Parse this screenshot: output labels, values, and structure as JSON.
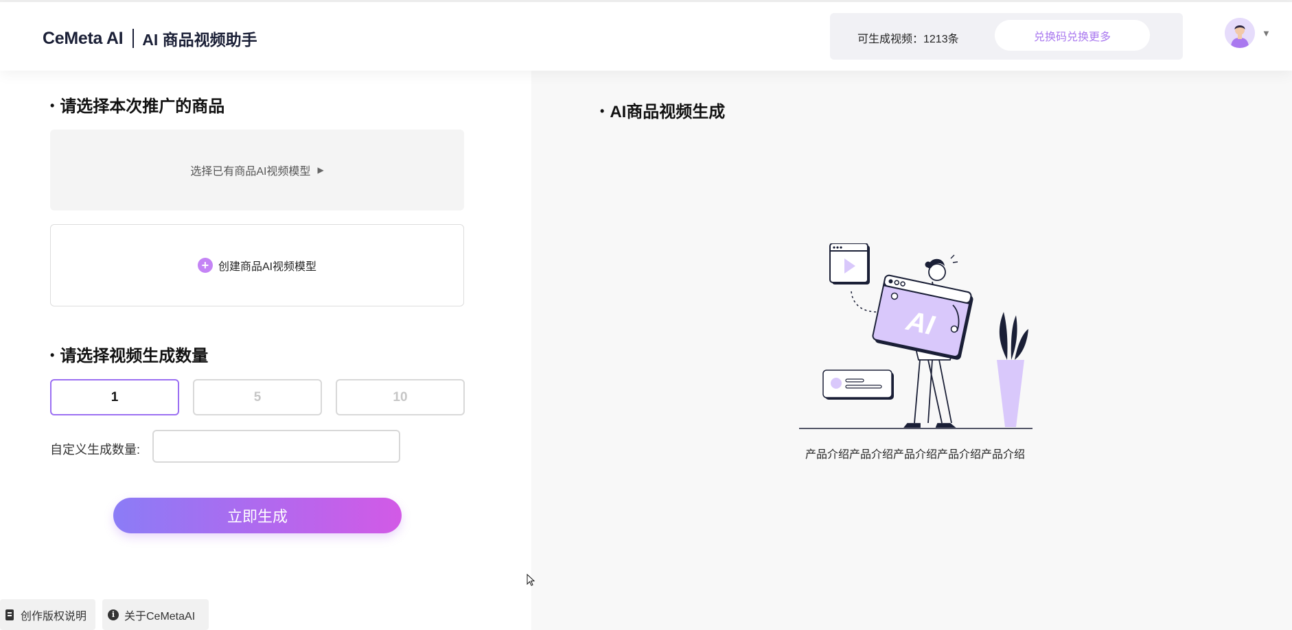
{
  "header": {
    "logo": "CeMeta AI",
    "app_title": "AI 商品视频助手",
    "quota": "可生成视频：1213条",
    "redeem_button": "兑换码兑换更多"
  },
  "left": {
    "section_product": "请选择本次推广的商品",
    "select_existing": "选择已有商品AI视频模型",
    "create_model": "创建商品AI视频模型",
    "section_quantity": "请选择视频生成数量",
    "quantity_options": [
      "1",
      "5",
      "10"
    ],
    "selected_quantity": "1",
    "custom_quantity_label": "自定义生成数量:",
    "custom_quantity_value": "",
    "generate_button": "立即生成"
  },
  "right": {
    "section_title": "AI商品视频生成",
    "illustration_text": "AI",
    "caption": "产品介绍产品介绍产品介绍产品介绍产品介绍"
  },
  "footer": {
    "copyright": "创作版权说明",
    "about": "关于CeMetaAI"
  },
  "colors": {
    "accent": "#a978ef",
    "active_border": "#9b6ff2",
    "gradient_start": "#8b7cf6",
    "gradient_end": "#d25ae6",
    "illustration_purple": "#d9c8fb",
    "dark_navy": "#1a1f36"
  },
  "icons": [
    "play-icon",
    "plus-circle-icon",
    "document-icon",
    "info-icon",
    "chevron-down-icon",
    "avatar-icon",
    "cursor-icon"
  ]
}
